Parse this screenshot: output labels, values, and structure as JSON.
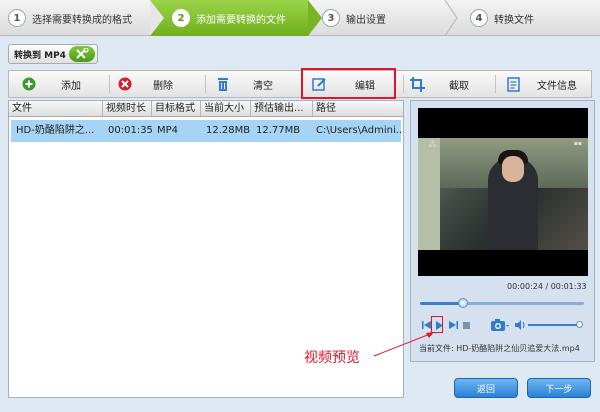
{
  "steps": [
    {
      "num": "1",
      "label": "选择需要转换成的格式"
    },
    {
      "num": "2",
      "label": "添加需要转换的文件"
    },
    {
      "num": "3",
      "label": "输出设置"
    },
    {
      "num": "4",
      "label": "转换文件"
    }
  ],
  "convert_to": {
    "label": "转换到 MP4"
  },
  "toolbar": {
    "add": "添加",
    "delete": "删除",
    "clear": "清空",
    "edit": "编辑",
    "crop": "截取",
    "info": "文件信息"
  },
  "table": {
    "headers": [
      "文件",
      "视频时长",
      "目标格式",
      "当前大小",
      "预估输出...",
      "路径"
    ],
    "rows": [
      [
        "HD-奶酪陷阱之...",
        "00:01:35",
        "MP4",
        "12.28MB",
        "12.77MB",
        "C:\\Users\\Admini..."
      ]
    ]
  },
  "preview": {
    "timecode": "00:00:24 / 00:01:33",
    "progress": 0.26,
    "volume": 1.0,
    "current_file": "当前文件: HD-奶酪陷阱之仙贝追爱大法.mp4"
  },
  "callout": "视频预览",
  "buttons": {
    "back": "返回",
    "next": "下一步"
  },
  "colors": {
    "accent_green": "#7cc234",
    "highlight_red": "#e0152b",
    "button_blue": "#2b7fd4",
    "row_selected": "#a6d4f7"
  }
}
